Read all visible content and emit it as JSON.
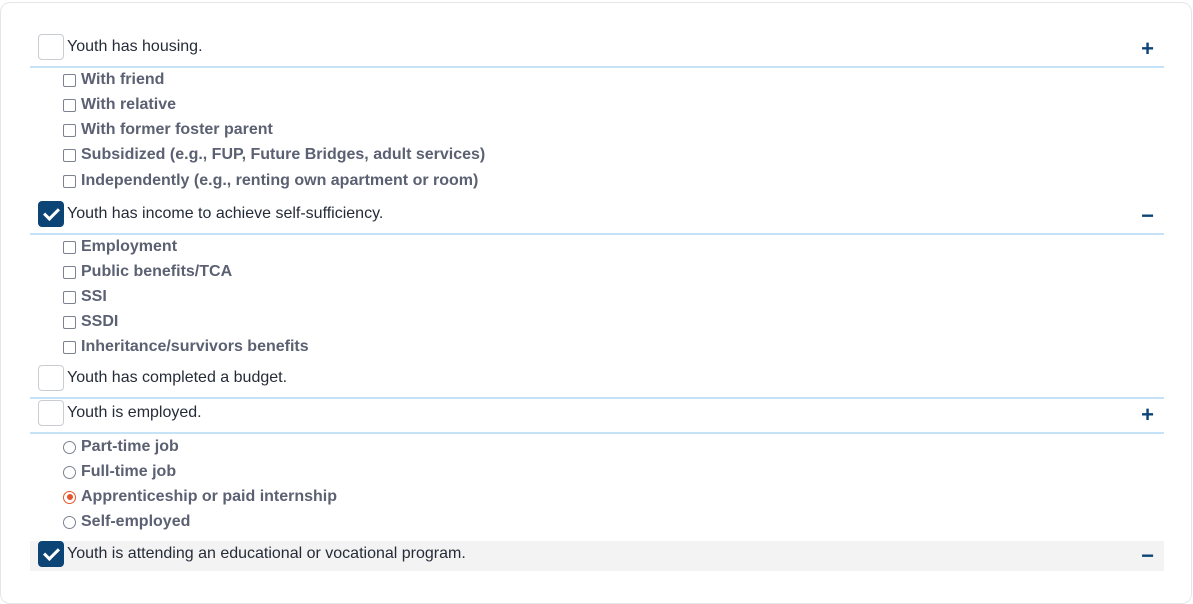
{
  "colors": {
    "accent": "#0d4476",
    "radio_selected": "#e4572e",
    "divider": "#c6e2f7"
  },
  "sections": [
    {
      "label": "Youth has housing.",
      "checked": false,
      "toggle": "+",
      "option_type": "checkbox",
      "options": [
        "With friend",
        "With relative",
        "With former foster parent",
        "Subsidized (e.g., FUP, Future Bridges, adult services)",
        "Independently (e.g., renting own apartment or room)"
      ]
    },
    {
      "label": "Youth has income to achieve self-sufficiency.",
      "checked": true,
      "toggle": "−",
      "option_type": "checkbox",
      "options": [
        "Employment",
        "Public benefits/TCA",
        "SSI",
        "SSDI",
        "Inheritance/survivors benefits"
      ]
    },
    {
      "label": "Youth has completed a budget.",
      "checked": false,
      "toggle": "",
      "options": []
    },
    {
      "label": "Youth is employed.",
      "checked": false,
      "toggle": "+",
      "option_type": "radio",
      "selected": "Apprenticeship or paid internship",
      "options": [
        "Part-time job",
        "Full-time job",
        "Apprenticeship or paid internship",
        "Self-employed"
      ]
    },
    {
      "label": "Youth is attending an educational or vocational program.",
      "checked": true,
      "toggle": "−",
      "options": []
    }
  ]
}
